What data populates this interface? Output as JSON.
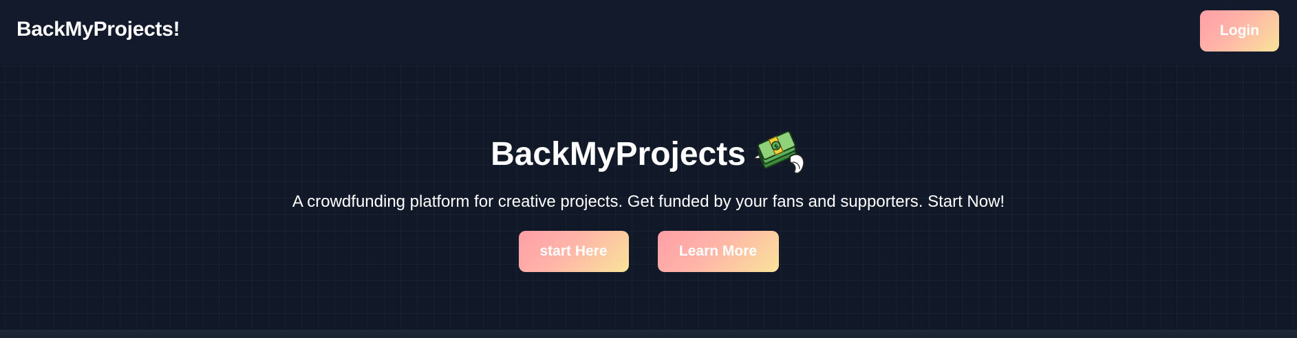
{
  "navbar": {
    "brand": "BackMyProjects!",
    "login_label": "Login"
  },
  "hero": {
    "title": "BackMyProjects",
    "title_icon": "money-with-wings-icon",
    "subtitle": "A crowdfunding platform for creative projects. Get funded by your fans and supporters. Start Now!",
    "primary_cta": "start Here",
    "secondary_cta": "Learn More"
  },
  "colors": {
    "background": "#111827",
    "button_gradient_start": "#ff9ea7",
    "button_gradient_end": "#f9e39a",
    "text": "#ffffff"
  }
}
